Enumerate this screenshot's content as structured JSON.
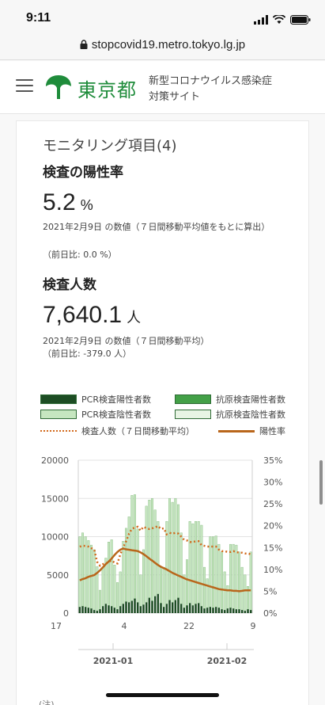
{
  "status": {
    "time": "9:11"
  },
  "browser": {
    "url": "stopcovid19.metro.tokyo.lg.jp"
  },
  "header": {
    "logo_text": "東京都",
    "site_title_line1": "新型コロナウイルス感染症",
    "site_title_line2": "対策サイト"
  },
  "card": {
    "title": "モニタリング項目(4)",
    "positivity": {
      "heading": "検査の陽性率",
      "value": "5.2",
      "unit": "%",
      "date_note": "2021年2月9日 の数値（７日間移動平均値をもとに算出）",
      "change_note": "（前日比: 0.0 %）"
    },
    "tests": {
      "heading": "検査人数",
      "value": "7,640.1",
      "unit": "人",
      "date_note": "2021年2月9日 の数値（７日間移動平均）",
      "change_note": "（前日比: -379.0 人）"
    },
    "legend": {
      "pcr_positive": "PCR検査陽性者数",
      "antigen_positive": "抗原検査陽性者数",
      "pcr_negative": "PCR検査陰性者数",
      "antigen_negative": "抗原検査陰性者数",
      "tests_avg": "検査人数（７日間移動平均）",
      "positivity_rate": "陽性率"
    },
    "note": "(注)"
  },
  "chart_data": {
    "type": "bar",
    "title": "",
    "x_ticks": [
      "17",
      "4",
      "22",
      "9"
    ],
    "months": [
      "2021-01",
      "2021-02"
    ],
    "y_left": {
      "ticks": [
        "0",
        "5000",
        "10000",
        "15000",
        "20000"
      ],
      "range": [
        0,
        20000
      ]
    },
    "y_right": {
      "ticks": [
        "0%",
        "5%",
        "10%",
        "15%",
        "20%",
        "25%",
        "30%",
        "35%"
      ],
      "range": [
        0,
        35
      ]
    },
    "colors": {
      "pcr_positive": "#1d4d24",
      "antigen_positive": "#43a047",
      "pcr_negative": "#c6e6c0",
      "antigen_negative": "#e8f4e4",
      "tests_avg": "#d26a1d",
      "positivity_rate": "#b9661b"
    },
    "series": [
      {
        "name": "PCR検査陽性者数",
        "values": [
          800,
          900,
          800,
          700,
          600,
          400,
          300,
          500,
          900,
          1200,
          1000,
          900,
          700,
          500,
          900,
          1200,
          1500,
          1400,
          1600,
          1900,
          1400,
          900,
          1100,
          1400,
          2000,
          1600,
          2200,
          2500,
          1300,
          800,
          1200,
          1700,
          1400,
          1700,
          2000,
          1200,
          700,
          1000,
          1300,
          1000,
          1200,
          1300,
          900,
          600,
          700,
          800,
          700,
          800,
          700,
          500,
          400,
          600,
          700,
          600,
          500,
          500,
          400,
          300,
          500,
          400
        ]
      },
      {
        "name": "PCR検査陰性者数",
        "values": [
          9200,
          9600,
          9200,
          8800,
          8300,
          7900,
          5800,
          2500,
          5100,
          6000,
          8300,
          8700,
          5600,
          3500,
          4500,
          8200,
          9600,
          11200,
          13800,
          13600,
          9600,
          4100,
          7200,
          12600,
          12800,
          13400,
          11300,
          9500,
          4700,
          5200,
          10800,
          13300,
          13100,
          13300,
          12200,
          9300,
          4300,
          6000,
          10700,
          10700,
          10800,
          10700,
          10600,
          5400,
          3800,
          9200,
          9300,
          9300,
          8300,
          7500,
          5000,
          3000,
          8300,
          8400,
          8400,
          7500,
          5600,
          4700,
          3000,
          7600
        ]
      },
      {
        "name": "検査人数（７日間移動平均）",
        "values": [
          8700,
          8800,
          8800,
          8700,
          8500,
          8300,
          6700,
          6200,
          6400,
          6500,
          6700,
          6900,
          6600,
          6500,
          7700,
          8600,
          9400,
          10400,
          11000,
          11200,
          11300,
          10800,
          11300,
          11100,
          11000,
          11100,
          11200,
          11400,
          11000,
          11100,
          10300,
          10500,
          10400,
          10500,
          10400,
          10000,
          9600,
          9500,
          9300,
          9300,
          9400,
          9400,
          8900,
          8800,
          8700,
          8700,
          8700,
          8700,
          8300,
          8100,
          8100,
          8000,
          8000,
          8100,
          8000,
          7900,
          7900,
          7800,
          7800,
          7700
        ]
      },
      {
        "name": "陽性率",
        "values": [
          7.5,
          7.8,
          8.0,
          8.3,
          8.5,
          8.7,
          9.2,
          9.8,
          10.5,
          11.2,
          11.8,
          12.5,
          13.3,
          14.0,
          14.5,
          14.8,
          14.6,
          14.5,
          14.4,
          14.3,
          14.2,
          13.9,
          13.5,
          13.0,
          12.5,
          12.0,
          11.5,
          11.0,
          10.6,
          10.3,
          10.0,
          9.6,
          9.2,
          8.9,
          8.6,
          8.3,
          8.0,
          7.7,
          7.5,
          7.3,
          7.1,
          6.9,
          6.7,
          6.5,
          6.3,
          6.1,
          5.9,
          5.7,
          5.5,
          5.4,
          5.3,
          5.2,
          5.2,
          5.1,
          5.1,
          5.0,
          5.1,
          5.2,
          5.2,
          5.2
        ]
      }
    ]
  }
}
